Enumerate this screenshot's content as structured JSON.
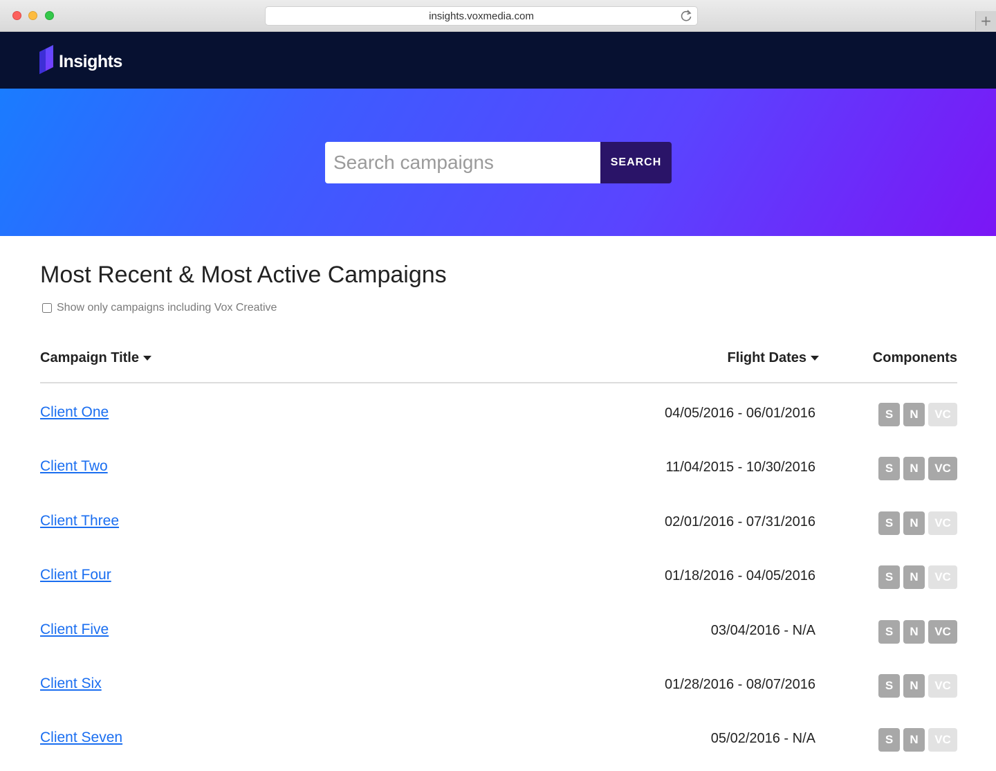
{
  "browser": {
    "url": "insights.voxmedia.com",
    "newtab_label": "+"
  },
  "nav": {
    "logo_text": "Insights"
  },
  "hero": {
    "search_placeholder": "Search campaigns",
    "search_button": "SEARCH"
  },
  "main": {
    "heading": "Most Recent & Most Active Campaigns",
    "filter_label": "Show only campaigns including Vox Creative",
    "filter_checked": false,
    "columns": {
      "title": "Campaign Title",
      "dates": "Flight Dates",
      "components": "Components"
    },
    "campaigns": [
      {
        "title": "Client One",
        "dates": "04/05/2016 - 06/01/2016",
        "s": "S",
        "n": "N",
        "vc": "VC",
        "s_on": true,
        "n_on": true,
        "vc_on": false
      },
      {
        "title": "Client Two",
        "dates": "11/04/2015 - 10/30/2016",
        "s": "S",
        "n": "N",
        "vc": "VC",
        "s_on": true,
        "n_on": true,
        "vc_on": true
      },
      {
        "title": "Client Three",
        "dates": "02/01/2016 - 07/31/2016",
        "s": "S",
        "n": "N",
        "vc": "VC",
        "s_on": true,
        "n_on": true,
        "vc_on": false
      },
      {
        "title": "Client Four",
        "dates": "01/18/2016 - 04/05/2016",
        "s": "S",
        "n": "N",
        "vc": "VC",
        "s_on": true,
        "n_on": true,
        "vc_on": false
      },
      {
        "title": "Client Five",
        "dates": "03/04/2016 - N/A",
        "s": "S",
        "n": "N",
        "vc": "VC",
        "s_on": true,
        "n_on": true,
        "vc_on": true
      },
      {
        "title": "Client Six",
        "dates": "01/28/2016 - 08/07/2016",
        "s": "S",
        "n": "N",
        "vc": "VC",
        "s_on": true,
        "n_on": true,
        "vc_on": false
      },
      {
        "title": "Client Seven",
        "dates": "05/02/2016 - N/A",
        "s": "S",
        "n": "N",
        "vc": "VC",
        "s_on": true,
        "n_on": true,
        "vc_on": false
      }
    ]
  },
  "colors": {
    "nav_bg": "#071131",
    "hero_start": "#1a7cff",
    "hero_end": "#7b16f5",
    "search_button_bg": "#2a1468",
    "link": "#1a6ef0",
    "badge_on": "#a8a8a8",
    "badge_off": "#e2e2e2"
  }
}
